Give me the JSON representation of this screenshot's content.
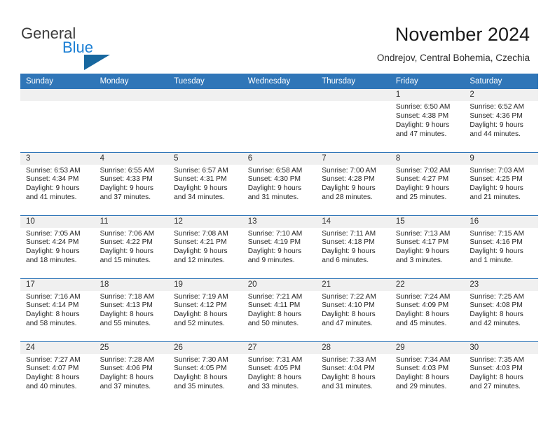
{
  "brand": {
    "word1": "General",
    "word2": "Blue",
    "flag_icon": "triangle-flag-icon",
    "color_primary": "#1b7fd4",
    "color_dark": "#3b3b3b"
  },
  "header": {
    "title": "November 2024",
    "subtitle": "Ondrejov, Central Bohemia, Czechia"
  },
  "theme": {
    "header_blue": "#3076b8",
    "daynum_band": "#f0f0f0",
    "text": "#262626"
  },
  "weekdays": [
    "Sunday",
    "Monday",
    "Tuesday",
    "Wednesday",
    "Thursday",
    "Friday",
    "Saturday"
  ],
  "weeks": [
    [
      {
        "day": "",
        "empty": true,
        "sunrise": "",
        "sunset": "",
        "daylight1": "",
        "daylight2": ""
      },
      {
        "day": "",
        "empty": true,
        "sunrise": "",
        "sunset": "",
        "daylight1": "",
        "daylight2": ""
      },
      {
        "day": "",
        "empty": true,
        "sunrise": "",
        "sunset": "",
        "daylight1": "",
        "daylight2": ""
      },
      {
        "day": "",
        "empty": true,
        "sunrise": "",
        "sunset": "",
        "daylight1": "",
        "daylight2": ""
      },
      {
        "day": "",
        "empty": true,
        "sunrise": "",
        "sunset": "",
        "daylight1": "",
        "daylight2": ""
      },
      {
        "day": "1",
        "sunrise": "Sunrise: 6:50 AM",
        "sunset": "Sunset: 4:38 PM",
        "daylight1": "Daylight: 9 hours",
        "daylight2": "and 47 minutes."
      },
      {
        "day": "2",
        "sunrise": "Sunrise: 6:52 AM",
        "sunset": "Sunset: 4:36 PM",
        "daylight1": "Daylight: 9 hours",
        "daylight2": "and 44 minutes."
      }
    ],
    [
      {
        "day": "3",
        "sunrise": "Sunrise: 6:53 AM",
        "sunset": "Sunset: 4:34 PM",
        "daylight1": "Daylight: 9 hours",
        "daylight2": "and 41 minutes."
      },
      {
        "day": "4",
        "sunrise": "Sunrise: 6:55 AM",
        "sunset": "Sunset: 4:33 PM",
        "daylight1": "Daylight: 9 hours",
        "daylight2": "and 37 minutes."
      },
      {
        "day": "5",
        "sunrise": "Sunrise: 6:57 AM",
        "sunset": "Sunset: 4:31 PM",
        "daylight1": "Daylight: 9 hours",
        "daylight2": "and 34 minutes."
      },
      {
        "day": "6",
        "sunrise": "Sunrise: 6:58 AM",
        "sunset": "Sunset: 4:30 PM",
        "daylight1": "Daylight: 9 hours",
        "daylight2": "and 31 minutes."
      },
      {
        "day": "7",
        "sunrise": "Sunrise: 7:00 AM",
        "sunset": "Sunset: 4:28 PM",
        "daylight1": "Daylight: 9 hours",
        "daylight2": "and 28 minutes."
      },
      {
        "day": "8",
        "sunrise": "Sunrise: 7:02 AM",
        "sunset": "Sunset: 4:27 PM",
        "daylight1": "Daylight: 9 hours",
        "daylight2": "and 25 minutes."
      },
      {
        "day": "9",
        "sunrise": "Sunrise: 7:03 AM",
        "sunset": "Sunset: 4:25 PM",
        "daylight1": "Daylight: 9 hours",
        "daylight2": "and 21 minutes."
      }
    ],
    [
      {
        "day": "10",
        "sunrise": "Sunrise: 7:05 AM",
        "sunset": "Sunset: 4:24 PM",
        "daylight1": "Daylight: 9 hours",
        "daylight2": "and 18 minutes."
      },
      {
        "day": "11",
        "sunrise": "Sunrise: 7:06 AM",
        "sunset": "Sunset: 4:22 PM",
        "daylight1": "Daylight: 9 hours",
        "daylight2": "and 15 minutes."
      },
      {
        "day": "12",
        "sunrise": "Sunrise: 7:08 AM",
        "sunset": "Sunset: 4:21 PM",
        "daylight1": "Daylight: 9 hours",
        "daylight2": "and 12 minutes."
      },
      {
        "day": "13",
        "sunrise": "Sunrise: 7:10 AM",
        "sunset": "Sunset: 4:19 PM",
        "daylight1": "Daylight: 9 hours",
        "daylight2": "and 9 minutes."
      },
      {
        "day": "14",
        "sunrise": "Sunrise: 7:11 AM",
        "sunset": "Sunset: 4:18 PM",
        "daylight1": "Daylight: 9 hours",
        "daylight2": "and 6 minutes."
      },
      {
        "day": "15",
        "sunrise": "Sunrise: 7:13 AM",
        "sunset": "Sunset: 4:17 PM",
        "daylight1": "Daylight: 9 hours",
        "daylight2": "and 3 minutes."
      },
      {
        "day": "16",
        "sunrise": "Sunrise: 7:15 AM",
        "sunset": "Sunset: 4:16 PM",
        "daylight1": "Daylight: 9 hours",
        "daylight2": "and 1 minute."
      }
    ],
    [
      {
        "day": "17",
        "sunrise": "Sunrise: 7:16 AM",
        "sunset": "Sunset: 4:14 PM",
        "daylight1": "Daylight: 8 hours",
        "daylight2": "and 58 minutes."
      },
      {
        "day": "18",
        "sunrise": "Sunrise: 7:18 AM",
        "sunset": "Sunset: 4:13 PM",
        "daylight1": "Daylight: 8 hours",
        "daylight2": "and 55 minutes."
      },
      {
        "day": "19",
        "sunrise": "Sunrise: 7:19 AM",
        "sunset": "Sunset: 4:12 PM",
        "daylight1": "Daylight: 8 hours",
        "daylight2": "and 52 minutes."
      },
      {
        "day": "20",
        "sunrise": "Sunrise: 7:21 AM",
        "sunset": "Sunset: 4:11 PM",
        "daylight1": "Daylight: 8 hours",
        "daylight2": "and 50 minutes."
      },
      {
        "day": "21",
        "sunrise": "Sunrise: 7:22 AM",
        "sunset": "Sunset: 4:10 PM",
        "daylight1": "Daylight: 8 hours",
        "daylight2": "and 47 minutes."
      },
      {
        "day": "22",
        "sunrise": "Sunrise: 7:24 AM",
        "sunset": "Sunset: 4:09 PM",
        "daylight1": "Daylight: 8 hours",
        "daylight2": "and 45 minutes."
      },
      {
        "day": "23",
        "sunrise": "Sunrise: 7:25 AM",
        "sunset": "Sunset: 4:08 PM",
        "daylight1": "Daylight: 8 hours",
        "daylight2": "and 42 minutes."
      }
    ],
    [
      {
        "day": "24",
        "sunrise": "Sunrise: 7:27 AM",
        "sunset": "Sunset: 4:07 PM",
        "daylight1": "Daylight: 8 hours",
        "daylight2": "and 40 minutes."
      },
      {
        "day": "25",
        "sunrise": "Sunrise: 7:28 AM",
        "sunset": "Sunset: 4:06 PM",
        "daylight1": "Daylight: 8 hours",
        "daylight2": "and 37 minutes."
      },
      {
        "day": "26",
        "sunrise": "Sunrise: 7:30 AM",
        "sunset": "Sunset: 4:05 PM",
        "daylight1": "Daylight: 8 hours",
        "daylight2": "and 35 minutes."
      },
      {
        "day": "27",
        "sunrise": "Sunrise: 7:31 AM",
        "sunset": "Sunset: 4:05 PM",
        "daylight1": "Daylight: 8 hours",
        "daylight2": "and 33 minutes."
      },
      {
        "day": "28",
        "sunrise": "Sunrise: 7:33 AM",
        "sunset": "Sunset: 4:04 PM",
        "daylight1": "Daylight: 8 hours",
        "daylight2": "and 31 minutes."
      },
      {
        "day": "29",
        "sunrise": "Sunrise: 7:34 AM",
        "sunset": "Sunset: 4:03 PM",
        "daylight1": "Daylight: 8 hours",
        "daylight2": "and 29 minutes."
      },
      {
        "day": "30",
        "sunrise": "Sunrise: 7:35 AM",
        "sunset": "Sunset: 4:03 PM",
        "daylight1": "Daylight: 8 hours",
        "daylight2": "and 27 minutes."
      }
    ]
  ]
}
